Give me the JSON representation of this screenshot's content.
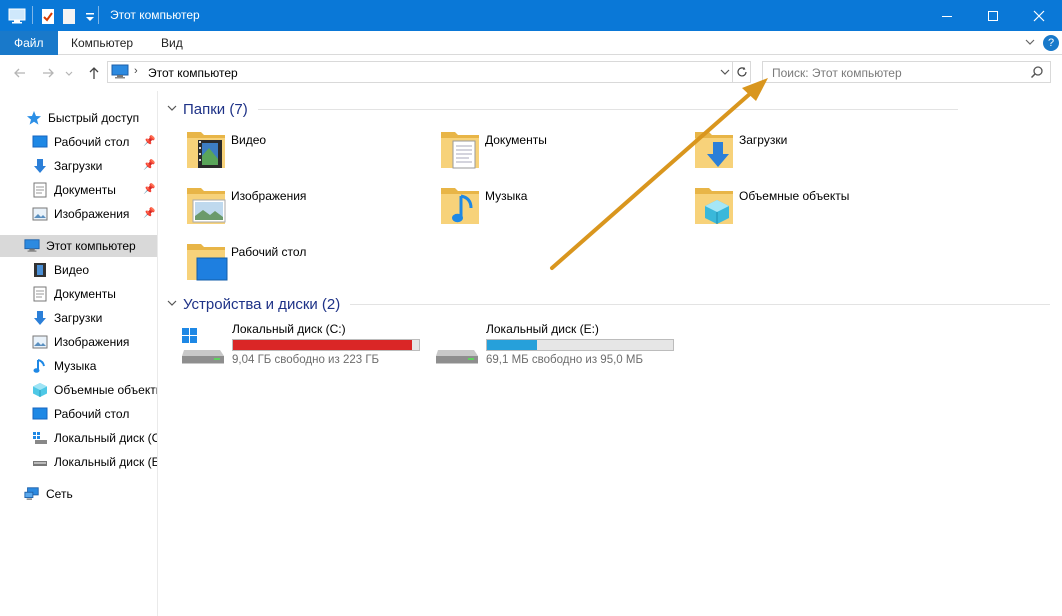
{
  "window": {
    "title": "Этот компьютер"
  },
  "ribbon": {
    "tabs": [
      "Файл",
      "Компьютер",
      "Вид"
    ]
  },
  "address": {
    "path": "Этот компьютер"
  },
  "search": {
    "placeholder": "Поиск: Этот компьютер"
  },
  "sidebar": {
    "quick_access": "Быстрый доступ",
    "quick_items": [
      "Рабочий стол",
      "Загрузки",
      "Документы",
      "Изображения"
    ],
    "this_pc": "Этот компьютер",
    "pc_items": [
      "Видео",
      "Документы",
      "Загрузки",
      "Изображения",
      "Музыка",
      "Объемные объекты",
      "Рабочий стол",
      "Локальный диск (C:)",
      "Локальный диск (E:)"
    ],
    "network": "Сеть"
  },
  "folders": {
    "header": "Папки (7)",
    "items": [
      "Видео",
      "Документы",
      "Загрузки",
      "Изображения",
      "Музыка",
      "Объемные объекты",
      "Рабочий стол"
    ]
  },
  "drives": {
    "header": "Устройства и диски (2)",
    "items": [
      {
        "name": "Локальный диск (C:)",
        "free": "9,04 ГБ свободно из 223 ГБ",
        "used_fraction": 0.96,
        "bar_color": "#da2626"
      },
      {
        "name": "Локальный диск (E:)",
        "free": "69,1 МБ свободно из 95,0 МБ",
        "used_fraction": 0.27,
        "bar_color": "#26a0da"
      }
    ]
  },
  "colors": {
    "titlebar": "#0a78d7",
    "accent": "#1979ca",
    "section": "#1e3287",
    "annotation": "#d9961e"
  }
}
